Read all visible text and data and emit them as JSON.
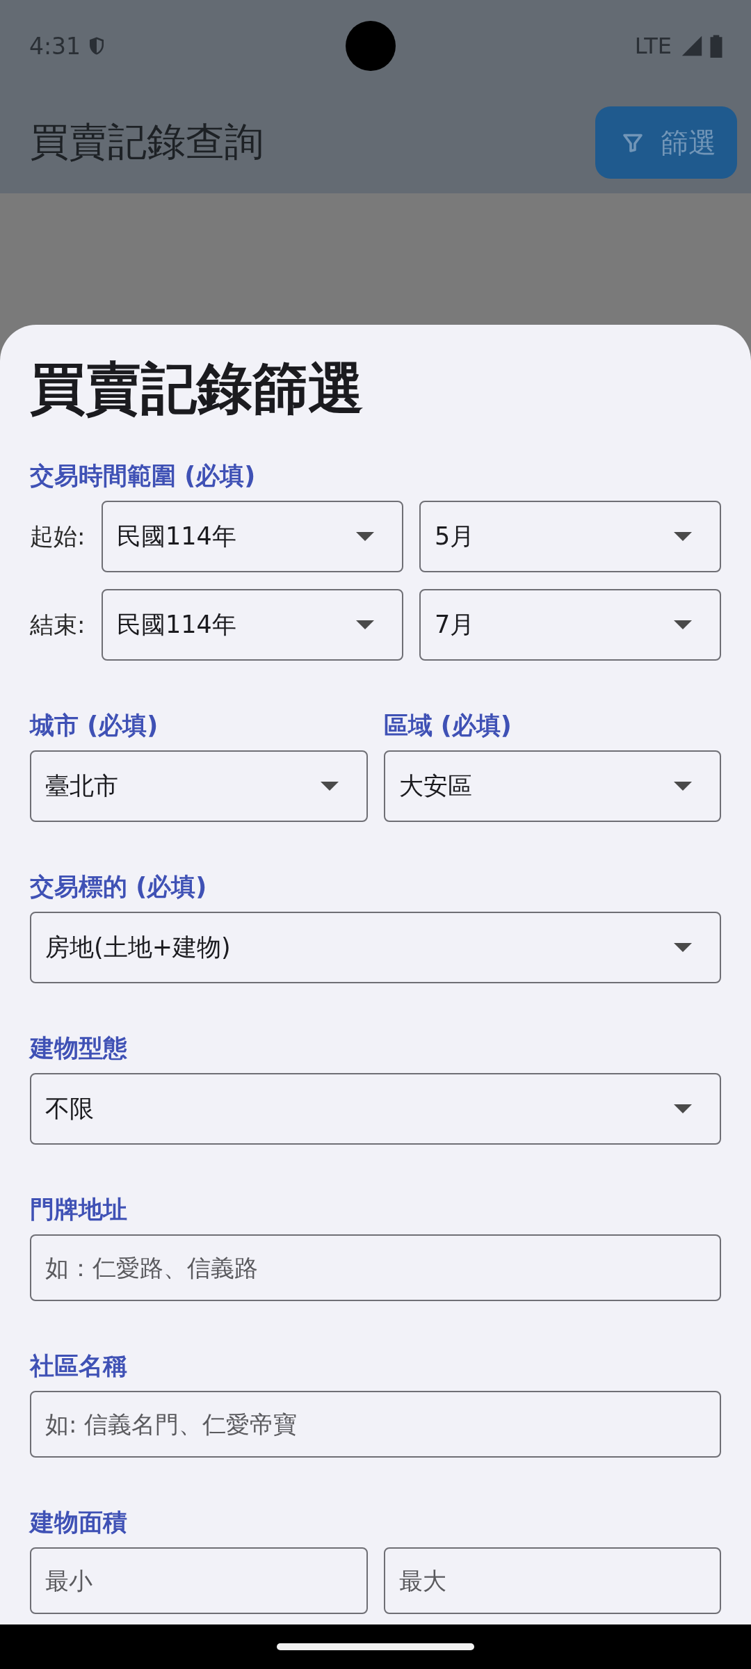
{
  "status_bar": {
    "time": "4:31",
    "network": "LTE"
  },
  "app_bar": {
    "title": "買賣記錄查詢",
    "filter_button": "篩選"
  },
  "sheet": {
    "title": "買賣記錄篩選",
    "sections": [
      {
        "label": "交易時間範圍 (必填)",
        "rows": [
          {
            "row_label": "起始:",
            "fields": [
              {
                "kind": "select",
                "value": "民國114年"
              },
              {
                "kind": "select",
                "value": "5月"
              }
            ]
          },
          {
            "row_label": "結束:",
            "fields": [
              {
                "kind": "select",
                "value": "民國114年"
              },
              {
                "kind": "select",
                "value": "7月"
              }
            ]
          }
        ]
      },
      {
        "columns": [
          {
            "label": "城市 (必填)",
            "field": {
              "kind": "select",
              "value": "臺北市"
            }
          },
          {
            "label": "區域 (必填)",
            "field": {
              "kind": "select",
              "value": "大安區"
            }
          }
        ]
      },
      {
        "label": "交易標的 (必填)",
        "rows": [
          {
            "fields": [
              {
                "kind": "select",
                "value": "房地(土地+建物)"
              }
            ]
          }
        ]
      },
      {
        "label": "建物型態",
        "rows": [
          {
            "fields": [
              {
                "kind": "select",
                "value": "不限"
              }
            ]
          }
        ]
      },
      {
        "label": "門牌地址",
        "rows": [
          {
            "fields": [
              {
                "kind": "text",
                "placeholder": "如：仁愛路、信義路"
              }
            ]
          }
        ]
      },
      {
        "label": "社區名稱",
        "rows": [
          {
            "fields": [
              {
                "kind": "text",
                "placeholder": "如: 信義名門、仁愛帝寶"
              }
            ]
          }
        ]
      },
      {
        "label": "建物面積",
        "rows": [
          {
            "fields": [
              {
                "kind": "text",
                "placeholder": "最小"
              },
              {
                "kind": "text",
                "placeholder": "最大"
              }
            ]
          }
        ]
      }
    ]
  }
}
